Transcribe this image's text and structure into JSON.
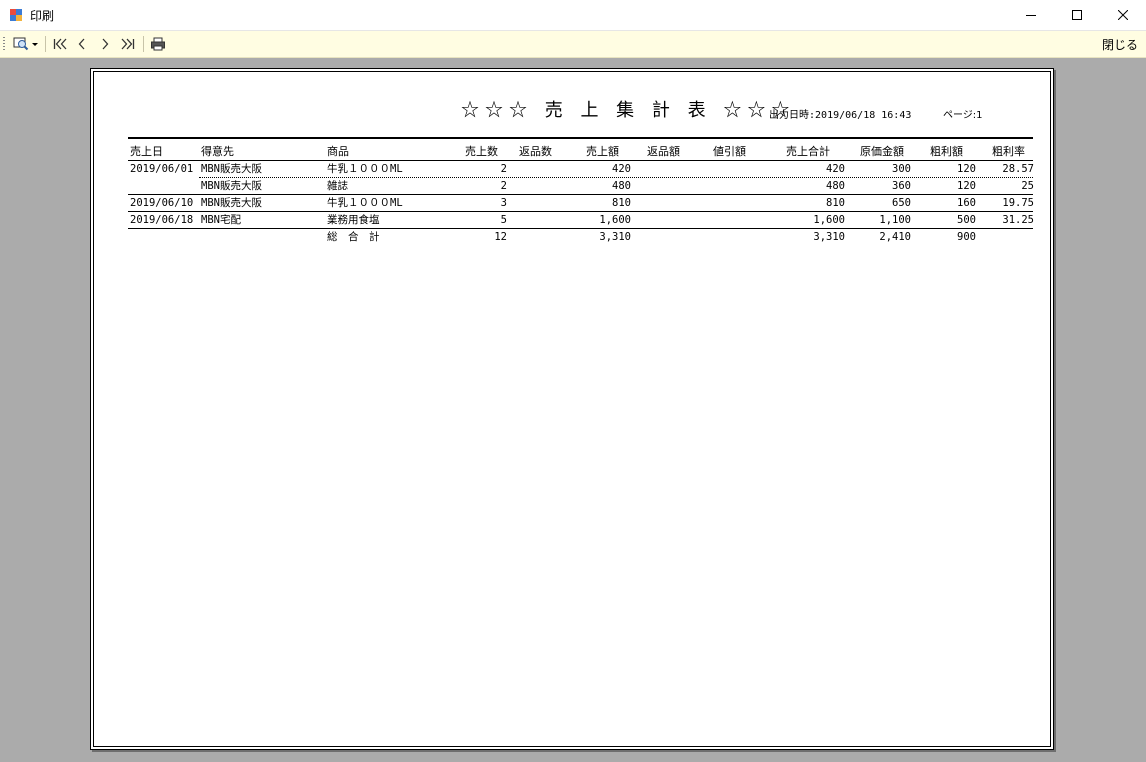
{
  "window": {
    "title": "印刷"
  },
  "toolbar": {
    "close_label": "閉じる",
    "icons": [
      "zoom-icon",
      "first-page-icon",
      "previous-page-icon",
      "next-page-icon",
      "last-page-icon",
      "print-icon"
    ]
  },
  "report": {
    "title": "☆☆☆ 売 上 集 計 表 ☆☆☆",
    "output_datetime_label": "出力日時:",
    "output_datetime": "2019/06/18 16:43",
    "page_label": "ページ:",
    "page_number": "1",
    "columns": [
      "売上日",
      "得意先",
      "商品",
      "売上数",
      "返品数",
      "売上額",
      "返品額",
      "値引額",
      "売上合計",
      "原価金額",
      "粗利額",
      "粗利率"
    ],
    "rows": [
      [
        "2019/06/01",
        "MBN販売大阪",
        "牛乳１０００ML",
        "2",
        "",
        "420",
        "",
        "",
        "420",
        "300",
        "120",
        "28.57"
      ],
      [
        "",
        "MBN販売大阪",
        "雑誌",
        "2",
        "",
        "480",
        "",
        "",
        "480",
        "360",
        "120",
        "25"
      ],
      [
        "2019/06/10",
        "MBN販売大阪",
        "牛乳１０００ML",
        "3",
        "",
        "810",
        "",
        "",
        "810",
        "650",
        "160",
        "19.75"
      ],
      [
        "2019/06/18",
        "MBN宅配",
        "業務用食塩",
        "5",
        "",
        "1,600",
        "",
        "",
        "1,600",
        "1,100",
        "500",
        "31.25"
      ]
    ],
    "total": {
      "label": "総　合　計",
      "sales_qty": "12",
      "sales_amount": "3,310",
      "sales_total": "3,310",
      "cost_amount": "2,410",
      "gross_profit": "900"
    }
  }
}
